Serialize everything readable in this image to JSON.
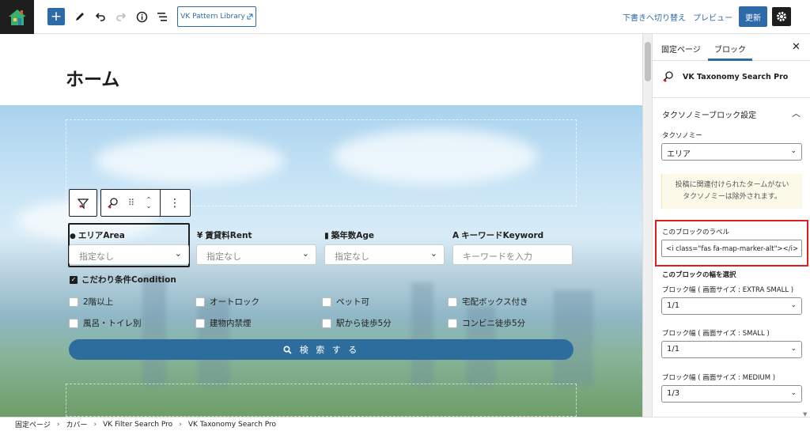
{
  "toolbar": {
    "pattern_library": "VK Pattern Library",
    "switch_to_draft": "下書きへ切り替え",
    "preview": "プレビュー",
    "update": "更新"
  },
  "page": {
    "title": "ホーム"
  },
  "search_form": {
    "area_label": "エリアArea",
    "area_value": "指定なし",
    "rent_label": "賃貸料Rent",
    "rent_value": "指定なし",
    "age_label": "築年数Age",
    "age_value": "指定なし",
    "keyword_label": "キーワードKeyword",
    "keyword_placeholder": "キーワードを入力",
    "condition_label": "こだわり条件Condition",
    "conditions": [
      "2階以上",
      "オートロック",
      "ペット可",
      "宅配ボックス付き",
      "風呂・トイレ別",
      "建物内禁煙",
      "駅から徒歩5分",
      "コンビニ徒歩5分"
    ],
    "search_button": "検 索 す る"
  },
  "sidebar": {
    "tab_page": "固定ページ",
    "tab_block": "ブロック",
    "block_name": "VK Taxonomy Search Pro",
    "panel_title": "タクソノミーブロック設定",
    "taxonomy_label": "タクソノミー",
    "taxonomy_value": "エリア",
    "notice_line1": "投稿に関連付けられたタームがない",
    "notice_line2": "タクソノミーは除外されます。",
    "block_label_title": "このブロックのラベル",
    "block_label_value": "<i class=\"fas fa-map-marker-alt\"></i> エ",
    "width_title": "このブロックの幅を選択",
    "width_xs_label": "ブロック幅 ( 画面サイズ : EXTRA SMALL )",
    "width_xs_value": "1/1",
    "width_sm_label": "ブロック幅 ( 画面サイズ : SMALL )",
    "width_sm_value": "1/1",
    "width_md_label": "ブロック幅 ( 画面サイズ : MEDIUM )",
    "width_md_value": "1/3"
  },
  "breadcrumb": {
    "items": [
      "固定ページ",
      "カバー",
      "VK Filter Search Pro",
      "VK Taxonomy Search Pro"
    ]
  },
  "colors": {
    "accent": "#2f6aa8",
    "search_button": "#2d6d9e",
    "highlight": "#e02020"
  }
}
